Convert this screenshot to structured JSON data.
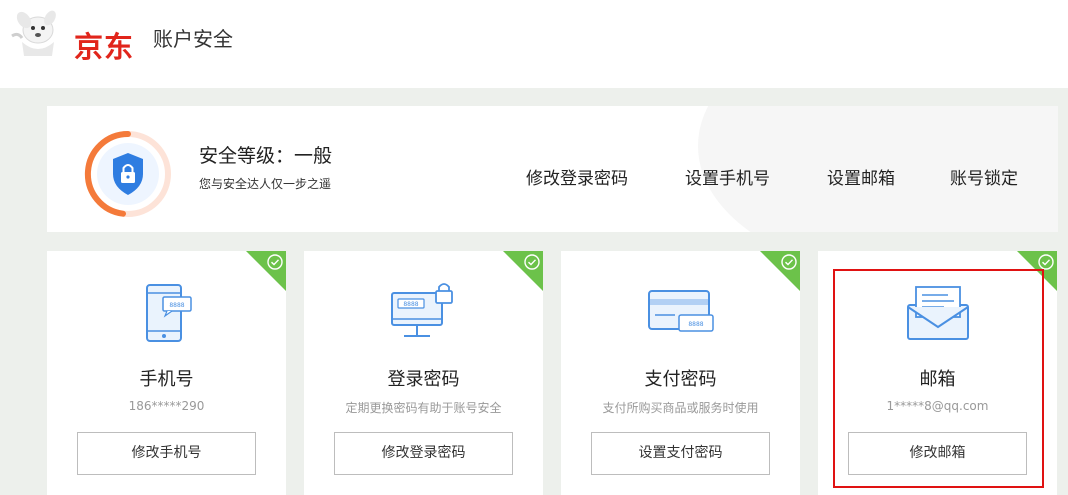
{
  "header": {
    "brand": "京东",
    "title": "账户安全",
    "brand_color": "#e1251b"
  },
  "summary": {
    "level_label": "安全等级：一般",
    "level_tip": "您与安全达人仅一步之遥",
    "links": [
      "修改登录密码",
      "设置手机号",
      "设置邮箱",
      "账号锁定"
    ]
  },
  "cards": [
    {
      "icon": "phone-message-icon",
      "title": "手机号",
      "desc": "186*****290",
      "button": "修改手机号"
    },
    {
      "icon": "monitor-lock-icon",
      "title": "登录密码",
      "desc": "定期更换密码有助于账号安全",
      "button": "修改登录密码"
    },
    {
      "icon": "card-password-icon",
      "title": "支付密码",
      "desc": "支付所购买商品或服务时使用",
      "button": "设置支付密码"
    },
    {
      "icon": "envelope-icon",
      "title": "邮箱",
      "desc": "1*****8@qq.com",
      "button": "修改邮箱"
    }
  ],
  "colors": {
    "accent_green": "#6cc24a",
    "icon_blue": "#4a90e2",
    "highlight_red": "#e01212"
  }
}
